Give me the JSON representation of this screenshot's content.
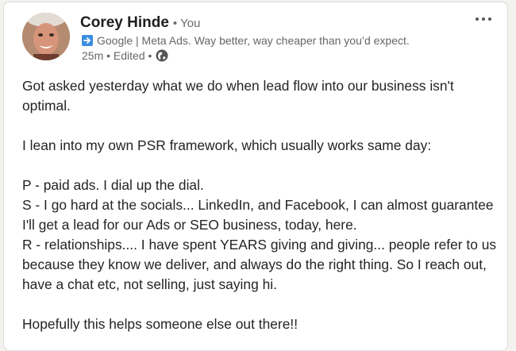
{
  "author": {
    "name": "Corey Hinde",
    "degree": "• You",
    "headline": "Google | Meta Ads. Way better, way cheaper than you’d expect.",
    "headline_icon": "right-arrow-emoji-icon",
    "meta": "25m • Edited •",
    "visibility_icon": "globe-icon"
  },
  "menu": {
    "icon": "more-options-icon",
    "label": "···"
  },
  "post": {
    "lines": [
      "Got asked yesterday what we do when lead flow into our business isn't",
      "optimal.",
      "",
      "I lean into my own PSR framework, which usually works same day:",
      "",
      "P - paid ads. I dial up the dial.",
      "S - I go hard at the socials... LinkedIn, and Facebook, I can almost guarantee",
      "I'll get a lead for our Ads or SEO business, today, here.",
      "R - relationships.... I have spent YEARS giving and giving... people refer to us",
      "because they know we deliver, and always do the right thing. So I reach out,",
      "have a chat etc, not selling, just saying hi.",
      "",
      "Hopefully this helps someone else out there!!"
    ]
  },
  "colors": {
    "card_background": "#ffffff",
    "page_background": "#f4f2ee",
    "text_primary": "#242424",
    "text_secondary": "#666666",
    "arrow_emoji": "#3b8ee0"
  }
}
